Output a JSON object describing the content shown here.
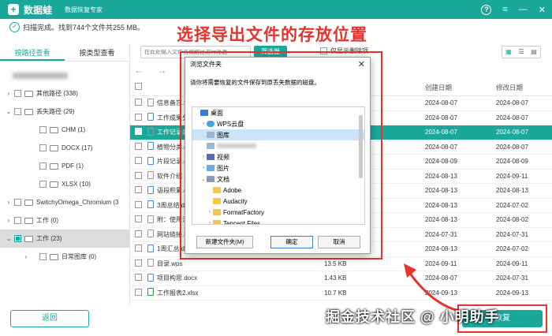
{
  "app": {
    "logo_mark": "+",
    "name": "数据蛙",
    "subtitle": "数据恢复专家"
  },
  "window_controls": {
    "help": "?",
    "menu": "≡",
    "minimize": "—",
    "close": "✕"
  },
  "scan_status": "扫描完成。找到744个文件共255 MB。",
  "annotation": "选择导出文件的存放位置",
  "tabs": [
    {
      "label": "按路径查看",
      "active": true
    },
    {
      "label": "按类型查看",
      "active": false
    }
  ],
  "tree": [
    {
      "label": "",
      "blurred": true,
      "caret": "",
      "indent": 0
    },
    {
      "label": "其他路径 (338)",
      "caret": "›",
      "indent": 0
    },
    {
      "label": "丢失路径 (29)",
      "caret": "⌄",
      "indent": 0
    },
    {
      "label": "CHM (1)",
      "caret": "",
      "indent": 1
    },
    {
      "label": "DOCX (17)",
      "caret": "",
      "indent": 1
    },
    {
      "label": "PDF (1)",
      "caret": "",
      "indent": 1
    },
    {
      "label": "XLSX (10)",
      "caret": "",
      "indent": 1
    },
    {
      "label": "SwitchyOmega_Chromium (3",
      "caret": "›",
      "indent": 0
    },
    {
      "label": "工作 (0)",
      "caret": "›",
      "indent": 0
    },
    {
      "label": "工作 (23)",
      "caret": "⌄",
      "indent": 0,
      "selected": true
    },
    {
      "label": "日常图库 (0)",
      "caret": "›",
      "indent": 1
    }
  ],
  "back_button": "返回",
  "toolbar": {
    "search_placeholder": "在此处输入文件名或路径进行筛选",
    "filter_label": "筛选器",
    "only_lost_label": "仅显示删除项",
    "view_icons": [
      "▦",
      "☰",
      "▤"
    ]
  },
  "nav": {
    "back": "←",
    "forward": "→"
  },
  "table": {
    "headers": {
      "name": "名",
      "size": "",
      "type": "",
      "created": "创建日期",
      "modified": "修改日期"
    },
    "rows": [
      {
        "name": "信息备忘.t",
        "size": "",
        "type": "",
        "created": "2024-08-07",
        "modified": "2024-08-07",
        "icon": "gen"
      },
      {
        "name": "工作成果分",
        "size": "",
        "type": "",
        "created": "2024-08-07",
        "modified": "2024-08-07",
        "icon": "doc"
      },
      {
        "name": "工作记录表",
        "size": "",
        "type": "",
        "created": "2024-08-07",
        "modified": "2024-08-07",
        "icon": "gen",
        "selected": true,
        "checked": true
      },
      {
        "name": "植物分类.d",
        "size": "",
        "type": "",
        "created": "2024-08-07",
        "modified": "2024-08-07",
        "icon": "doc"
      },
      {
        "name": "片段记录.d",
        "size": "",
        "type": "",
        "created": "2024-08-09",
        "modified": "2024-08-09",
        "icon": "doc"
      },
      {
        "name": "软件介绍 -",
        "size": "",
        "type": "",
        "created": "2024-08-13",
        "modified": "2024-09-11",
        "icon": "gen"
      },
      {
        "name": "语段积累.d",
        "size": "",
        "type": "",
        "created": "2024-08-13",
        "modified": "2024-08-13",
        "icon": "doc"
      },
      {
        "name": "3周总结.doc",
        "size": "",
        "type": "",
        "created": "2024-08-13",
        "modified": "2024-07-02",
        "icon": "doc"
      },
      {
        "name": "附：使用注",
        "size": "",
        "type": "",
        "created": "2024-08-13",
        "modified": "2024-08-02",
        "icon": "gen"
      },
      {
        "name": "网站链接.t",
        "size": "",
        "type": "",
        "created": "2024-07-31",
        "modified": "2024-07-31",
        "icon": "gen"
      },
      {
        "name": "1周汇总.docx",
        "size": "",
        "type": "",
        "created": "2024-08-13",
        "modified": "2024-07-02",
        "icon": "doc"
      },
      {
        "name": "目录.wps",
        "size": "13.5 KB",
        "type": "",
        "created": "2024-09-11",
        "modified": "2024-09-11",
        "icon": "gen"
      },
      {
        "name": "项目构思.docx",
        "size": "1.43 KB",
        "type": "",
        "created": "2024-08-07",
        "modified": "2024-07-31",
        "icon": "doc"
      },
      {
        "name": "工作报表2.xlsx",
        "size": "10.7 KB",
        "type": "",
        "created": "2024-09-13",
        "modified": "2024-09-13",
        "icon": "xls"
      }
    ]
  },
  "dialog": {
    "title": "浏览文件夹",
    "close": "✕",
    "message": "请你将需要恢复的文件保存到原丢失数据的磁盘。",
    "tree": [
      {
        "label": "桌面",
        "icon": "desk",
        "caret": "",
        "level": 0
      },
      {
        "label": "WPS云盘",
        "icon": "cloud",
        "caret": "›",
        "level": 1
      },
      {
        "label": "图库",
        "icon": "img",
        "caret": "",
        "level": 1,
        "highlight": true
      },
      {
        "label": "",
        "icon": "img",
        "caret": "",
        "level": 1,
        "blurred": true
      },
      {
        "label": "视频",
        "icon": "video",
        "caret": "›",
        "level": 1
      },
      {
        "label": "图片",
        "icon": "pic",
        "caret": "›",
        "level": 1
      },
      {
        "label": "文档",
        "icon": "doc",
        "caret": "⌄",
        "level": 1
      },
      {
        "label": "Adobe",
        "icon": "folder",
        "caret": "",
        "level": 2
      },
      {
        "label": "Audacity",
        "icon": "folder",
        "caret": "",
        "level": 2
      },
      {
        "label": "FormatFactory",
        "icon": "folder",
        "caret": "›",
        "level": 2
      },
      {
        "label": "Tencent Files",
        "icon": "folder",
        "caret": "›",
        "level": 2
      },
      {
        "label": "WPSDrive",
        "icon": "folder",
        "caret": "",
        "level": 2
      }
    ],
    "new_folder_button": "新建文件夹(M)",
    "ok_button": "确定",
    "cancel_button": "取消"
  },
  "watermark": "掘金技术社区 @ 小明助手",
  "recover_button": "恢复"
}
